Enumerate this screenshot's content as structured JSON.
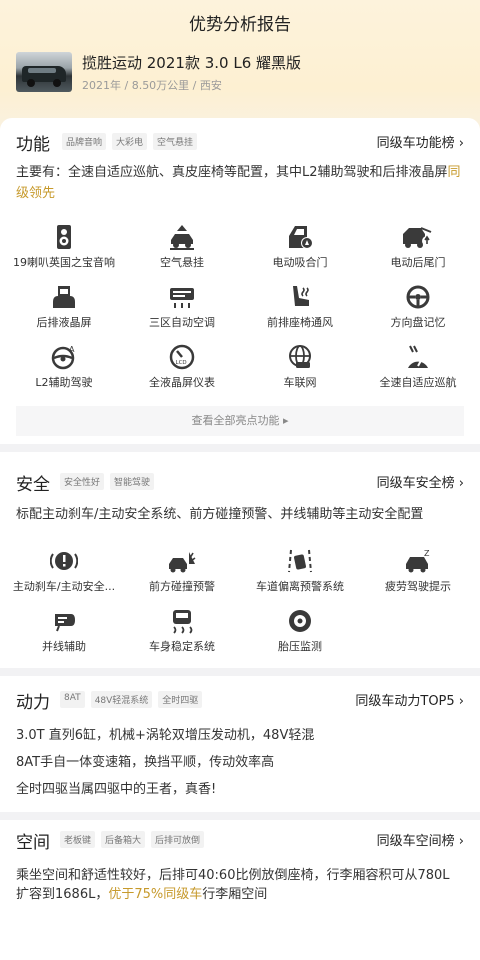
{
  "header": {
    "title": "优势分析报告"
  },
  "car": {
    "name": "揽胜运动 2021款 3.0 L6 耀黑版",
    "meta": "2021年 / 8.50万公里 / 西安"
  },
  "function": {
    "title": "功能",
    "tags": [
      "品牌音响",
      "大彩电",
      "空气悬挂"
    ],
    "rank_link": "同级车功能榜 ›",
    "desc_prefix": "主要有：全速自适应巡航、真皮座椅等配置，其中L2辅助驾驶和后排液晶屏",
    "desc_highlight": "同级领先",
    "features": [
      {
        "label": "19喇叭英国之宝音响",
        "icon": "speaker-icon"
      },
      {
        "label": "空气悬挂",
        "icon": "air-suspension-icon"
      },
      {
        "label": "电动吸合门",
        "icon": "soft-close-door-icon"
      },
      {
        "label": "电动后尾门",
        "icon": "power-tailgate-icon"
      },
      {
        "label": "后排液晶屏",
        "icon": "rear-screen-icon"
      },
      {
        "label": "三区自动空调",
        "icon": "climate-control-icon"
      },
      {
        "label": "前排座椅通风",
        "icon": "seat-ventilation-icon"
      },
      {
        "label": "方向盘记忆",
        "icon": "steering-memory-icon"
      },
      {
        "label": "L2辅助驾驶",
        "icon": "l2-assist-icon"
      },
      {
        "label": "全液晶屏仪表",
        "icon": "lcd-cluster-icon"
      },
      {
        "label": "车联网",
        "icon": "connected-car-icon"
      },
      {
        "label": "全速自适应巡航",
        "icon": "adaptive-cruise-icon"
      }
    ],
    "more_label": "查看全部亮点功能 ▸"
  },
  "safety": {
    "title": "安全",
    "tags": [
      "安全性好",
      "智能驾驶"
    ],
    "rank_link": "同级车安全榜 ›",
    "desc": "标配主动刹车/主动安全系统、前方碰撞预警、并线辅助等主动安全配置",
    "features": [
      {
        "label": "主动刹车/主动安全...",
        "icon": "active-brake-icon"
      },
      {
        "label": "前方碰撞预警",
        "icon": "collision-warning-icon"
      },
      {
        "label": "车道偏离预警系统",
        "icon": "lane-departure-icon"
      },
      {
        "label": "疲劳驾驶提示",
        "icon": "fatigue-alert-icon"
      },
      {
        "label": "并线辅助",
        "icon": "blind-spot-icon"
      },
      {
        "label": "车身稳定系统",
        "icon": "stability-control-icon"
      },
      {
        "label": "胎压监测",
        "icon": "tire-pressure-icon"
      }
    ]
  },
  "power": {
    "title": "动力",
    "tags": [
      "8AT",
      "48V轻混系统",
      "全时四驱"
    ],
    "rank_link": "同级车动力TOP5 ›",
    "lines": [
      "3.0T 直列6缸，机械+涡轮双增压发动机，48V轻混",
      "8AT手自一体变速箱，换挡平顺，传动效率高",
      "全时四驱当属四驱中的王者，真香!"
    ]
  },
  "space": {
    "title": "空间",
    "tags": [
      "老板键",
      "后备箱大",
      "后排可放倒"
    ],
    "rank_link": "同级车空间榜 ›",
    "desc_line1": "乘坐空间和舒适性较好，后排可40:60比例放倒座椅，行李厢容积可从780L",
    "desc_line2_prefix": "扩容到1686L，",
    "desc_highlight": "优于75%同级车",
    "desc_line2_suffix": "行李厢空间"
  },
  "colors": {
    "accent": "#c79a2c",
    "icon": "#3a3a3a",
    "hero": "#fdf1d6"
  }
}
